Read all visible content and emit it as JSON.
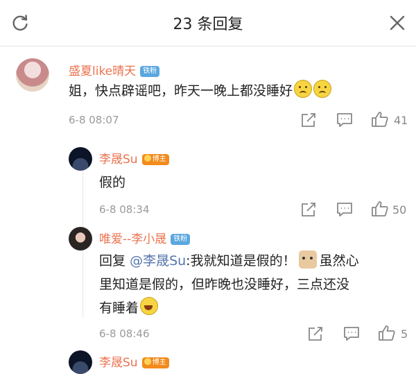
{
  "header": {
    "title": "23 条回复",
    "refresh_icon": "refresh-icon",
    "close_icon": "close-icon"
  },
  "comments": [
    {
      "username": "盛夏like晴天",
      "badge": "铁粉",
      "text": "姐，快点辟谣吧，昨天一晚上都没睡好",
      "emojis": [
        "sad-face-emoji",
        "sad-face-emoji"
      ],
      "time": "6-8 08:07",
      "likes": "41"
    },
    {
      "username": "李晟Su",
      "badge": "博主",
      "text": "假的",
      "time": "6-8 08:34",
      "likes": "50"
    },
    {
      "username": "唯爱--李小晟",
      "badge": "铁粉",
      "reply_prefix": "回复",
      "mention": "@李晟Su",
      "text_part1": ":我就知道是假的！",
      "text_line1_end": "虽然心",
      "text_line2": "里知道是假的，但昨晚也没睡好，三点还没",
      "text_line3": "有睡着",
      "time": "6-8 08:46",
      "likes": "5"
    },
    {
      "username": "李晟Su",
      "badge": "博主"
    }
  ],
  "colors": {
    "username": "#eb7350",
    "mention": "#5576ad",
    "fan_badge": "#5aa7e0",
    "blogger_badge": "#f28b1c"
  }
}
